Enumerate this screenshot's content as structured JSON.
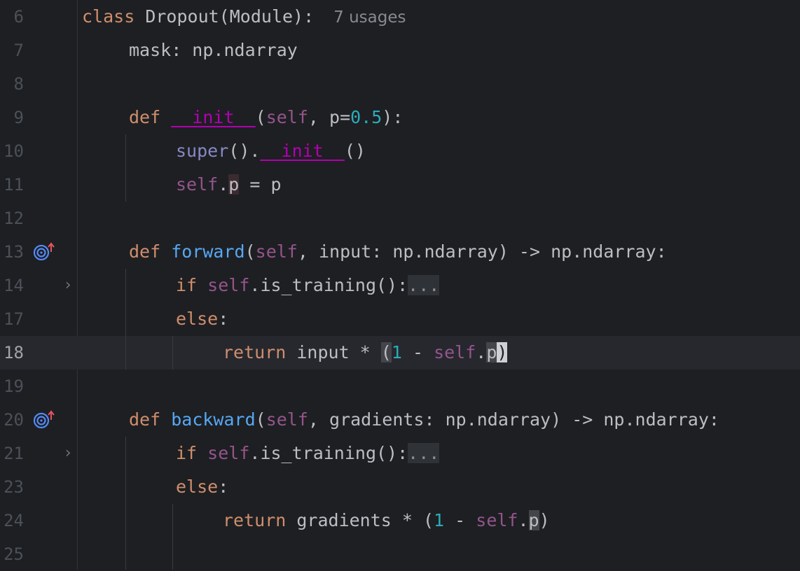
{
  "editor": {
    "lines": [
      {
        "number": "6",
        "tokens": [
          "class",
          "Dropout(Module):"
        ],
        "inlay_hint": "7 usages"
      },
      {
        "number": "7",
        "tokens": [
          "mask: np.ndarray"
        ]
      },
      {
        "number": "8",
        "tokens": []
      },
      {
        "number": "9",
        "tokens": [
          "def",
          "__init__",
          "(",
          "self",
          ", p=",
          "0.5",
          "):"
        ]
      },
      {
        "number": "10",
        "tokens": [
          "super",
          "().",
          "__init__",
          "()"
        ]
      },
      {
        "number": "11",
        "tokens": [
          "self",
          ".",
          "p",
          " = p"
        ]
      },
      {
        "number": "12",
        "tokens": []
      },
      {
        "number": "13",
        "tokens": [
          "def",
          "forward",
          "(",
          "self",
          ", input: np.ndarray) -> np.ndarray:"
        ],
        "gutter_icon": "override-method-icon"
      },
      {
        "number": "14",
        "tokens": [
          "if",
          "self",
          ".is_training():",
          "..."
        ],
        "fold": "collapsed"
      },
      {
        "number": "17",
        "tokens": [
          "else",
          ":"
        ]
      },
      {
        "number": "18",
        "tokens": [
          "return",
          "input * ",
          "(",
          "1",
          " - ",
          "self",
          ".",
          "p",
          ")"
        ],
        "current": true
      },
      {
        "number": "19",
        "tokens": []
      },
      {
        "number": "20",
        "tokens": [
          "def",
          "backward",
          "(",
          "self",
          ", gradients: np.ndarray) -> np.ndarray:"
        ],
        "gutter_icon": "override-method-icon"
      },
      {
        "number": "21",
        "tokens": [
          "if",
          "self",
          ".is_training():",
          "..."
        ],
        "fold": "collapsed"
      },
      {
        "number": "23",
        "tokens": [
          "else",
          ":"
        ]
      },
      {
        "number": "24",
        "tokens": [
          "return",
          "gradients * (",
          "1",
          " - ",
          "self",
          ".",
          "p",
          ")"
        ]
      },
      {
        "number": "25",
        "tokens": []
      }
    ]
  },
  "colors": {
    "background": "#1e1f22",
    "current_line": "#26282e",
    "keyword": "#cf8e6d",
    "function": "#56a8f5",
    "self": "#94558d",
    "dunder": "#b200b2",
    "number": "#2aacb8",
    "builtin": "#8888c6",
    "text": "#bcbec4"
  }
}
